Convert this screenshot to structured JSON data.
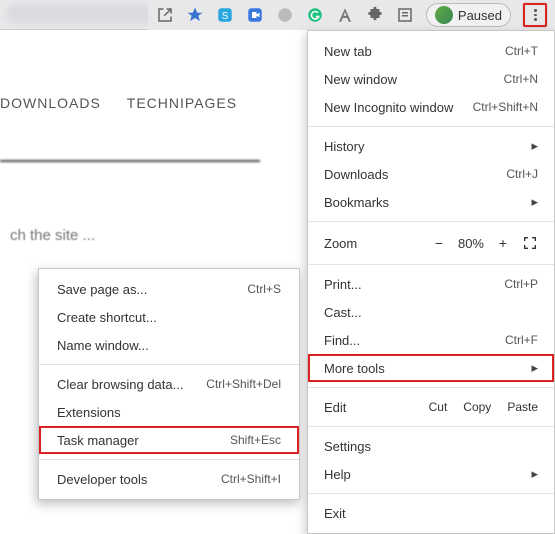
{
  "page": {
    "tab_downloads": "DOWNLOADS",
    "tab_technipages": "TECHNIPAGES",
    "search_placeholder": "ch the site ..."
  },
  "toolbar": {
    "paused_label": "Paused"
  },
  "menu": {
    "new_tab": "New tab",
    "new_tab_sc": "Ctrl+T",
    "new_window": "New window",
    "new_window_sc": "Ctrl+N",
    "incognito": "New Incognito window",
    "incognito_sc": "Ctrl+Shift+N",
    "history": "History",
    "downloads": "Downloads",
    "downloads_sc": "Ctrl+J",
    "bookmarks": "Bookmarks",
    "zoom": "Zoom",
    "zoom_minus": "−",
    "zoom_value": "80%",
    "zoom_plus": "+",
    "print": "Print...",
    "print_sc": "Ctrl+P",
    "cast": "Cast...",
    "find": "Find...",
    "find_sc": "Ctrl+F",
    "more_tools": "More tools",
    "edit": "Edit",
    "cut": "Cut",
    "copy": "Copy",
    "paste": "Paste",
    "settings": "Settings",
    "help": "Help",
    "exit": "Exit"
  },
  "submenu": {
    "save_page": "Save page as...",
    "save_page_sc": "Ctrl+S",
    "create_shortcut": "Create shortcut...",
    "name_window": "Name window...",
    "clear_data": "Clear browsing data...",
    "clear_data_sc": "Ctrl+Shift+Del",
    "extensions": "Extensions",
    "task_manager": "Task manager",
    "task_manager_sc": "Shift+Esc",
    "dev_tools": "Developer tools",
    "dev_tools_sc": "Ctrl+Shift+I"
  }
}
